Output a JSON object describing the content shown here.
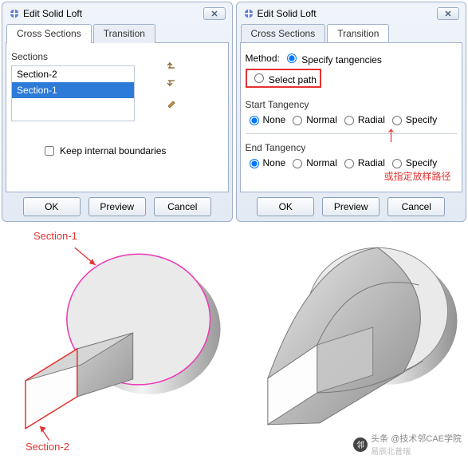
{
  "dialog": {
    "title": "Edit Solid Loft",
    "tabs": {
      "cross_sections": "Cross Sections",
      "transition": "Transition"
    },
    "buttons": {
      "ok": "OK",
      "preview": "Preview",
      "cancel": "Cancel"
    }
  },
  "left_panel": {
    "sections_label": "Sections",
    "items": [
      "Section-2",
      "Section-1"
    ],
    "selected_index": 1,
    "keep_boundaries": "Keep internal boundaries"
  },
  "right_panel": {
    "method_label": "Method:",
    "method_options": {
      "specify_tangencies": "Specify tangencies",
      "select_path": "Select path"
    },
    "start_tangency": {
      "label": "Start Tangency",
      "options": [
        "None",
        "Normal",
        "Radial",
        "Specify"
      ],
      "selected": 0
    },
    "end_tangency": {
      "label": "End Tangency",
      "options": [
        "None",
        "Normal",
        "Radial",
        "Specify"
      ],
      "selected": 0
    },
    "annotation": "或指定放样路径"
  },
  "scene_labels": {
    "s1": "Section-1",
    "s2": "Section-2"
  },
  "watermark": {
    "line1": "头条 @技术邻CAE学院",
    "line2": "易辰北普瑞"
  }
}
